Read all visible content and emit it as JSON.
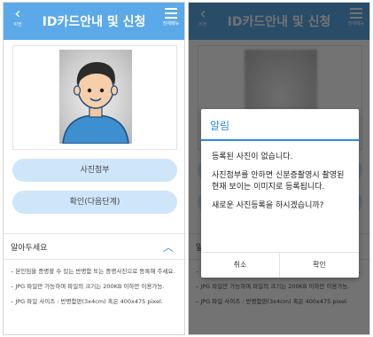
{
  "header": {
    "title": "ID카드안내 및 신청",
    "back_caption": "이전",
    "menu_caption": "전체메뉴"
  },
  "buttons": {
    "attach_photo": "사진첨부",
    "confirm_next": "확인(다음단계)"
  },
  "notice": {
    "title": "알아두세요",
    "items": [
      "– 본인임을 증명할 수 있는 반명함 또는 증명사진으로 등록해 주세요.",
      "– JPG 파일만 가능하며 파일의 크기는 200KB 이하만 이용가능.",
      "– JPG 파일 사이즈 : 반명함판(3x4cm) 혹은 400x475 pixel."
    ]
  },
  "dialog": {
    "title": "알림",
    "lines": [
      "등록된 사진이 없습니다.",
      "사진첨부를 안하면 신분증촬영시 촬영된 현재 보이는 이미지로 등록됩니다.",
      "새로운 사진등록을 하시겠습니까?"
    ],
    "cancel": "취소",
    "ok": "확인"
  },
  "colors": {
    "header": "#5ba9e8",
    "button": "#cfe6fa",
    "accent": "#2a8be0"
  }
}
